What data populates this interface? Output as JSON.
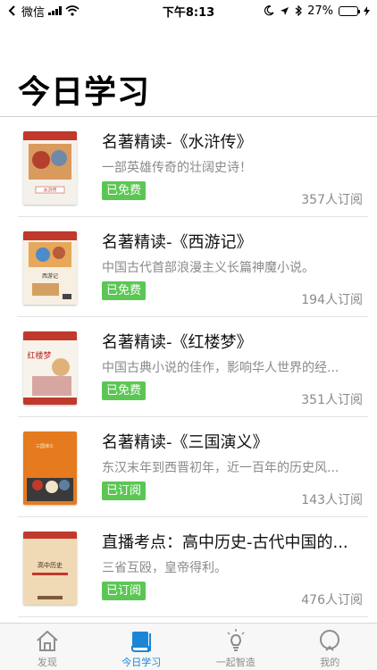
{
  "status_bar": {
    "carrier": "微信",
    "time": "下午8:13",
    "battery_text": "27%",
    "battery_level": 0.27
  },
  "header": {
    "title": "今日学习"
  },
  "items": [
    {
      "title": "名著精读-《水浒传》",
      "desc": "一部英雄传奇的壮阔史诗！",
      "badge": "已免费",
      "subs": "357人订阅",
      "cover_text": "水浒传"
    },
    {
      "title": "名著精读-《西游记》",
      "desc": "中国古代首部浪漫主义长篇神魔小说。",
      "badge": "已免费",
      "subs": "194人订阅",
      "cover_text": "西游记"
    },
    {
      "title": "名著精读-《红楼梦》",
      "desc": "中国古典小说的佳作，影响华人世界的经...",
      "badge": "已免费",
      "subs": "351人订阅",
      "cover_text": "红楼梦"
    },
    {
      "title": "名著精读-《三国演义》",
      "desc": "东汉末年到西晋初年，近一百年的历史风...",
      "badge": "已订阅",
      "subs": "143人订阅",
      "cover_text": "三国演义"
    },
    {
      "title": "直播考点：高中历史-古代中国的...",
      "desc": "三省互殴，皇帝得利。",
      "badge": "已订阅",
      "subs": "476人订阅",
      "cover_text": "高中历史"
    }
  ],
  "tabs": [
    {
      "label": "发现",
      "icon": "home-icon"
    },
    {
      "label": "今日学习",
      "icon": "book-icon"
    },
    {
      "label": "一起智造",
      "icon": "lightbulb-icon"
    },
    {
      "label": "我的",
      "icon": "profile-icon"
    }
  ],
  "colors": {
    "accent": "#1c86d6",
    "badge": "#5cc655",
    "muted_text": "#8a8a8a"
  }
}
